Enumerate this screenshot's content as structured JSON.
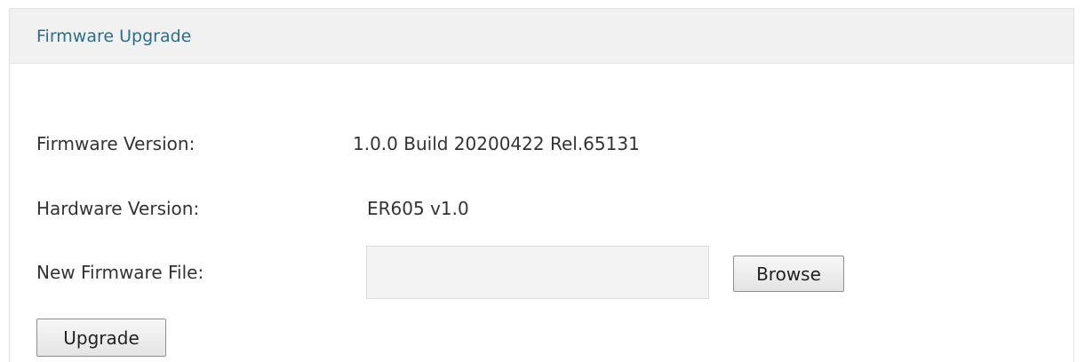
{
  "panel": {
    "title": "Firmware Upgrade"
  },
  "fields": {
    "firmware_version": {
      "label": "Firmware Version:",
      "value": "1.0.0 Build 20200422 Rel.65131"
    },
    "hardware_version": {
      "label": "Hardware Version:",
      "value": "ER605 v1.0"
    },
    "new_firmware_file": {
      "label": "New Firmware File:",
      "value": "",
      "placeholder": ""
    }
  },
  "buttons": {
    "browse_label": "Browse",
    "upgrade_label": "Upgrade"
  }
}
